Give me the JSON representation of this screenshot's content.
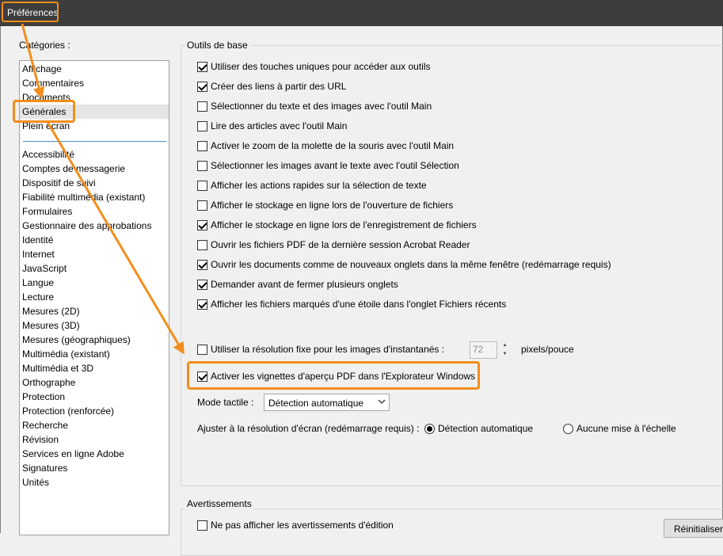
{
  "window": {
    "title": "Préférences"
  },
  "sidebar": {
    "label": "Catégories :",
    "top_items": [
      "Affichage",
      "Commentaires",
      "Documents",
      "Générales",
      "Plein écran"
    ],
    "selected": "Générales",
    "items": [
      "Accessibilité",
      "Comptes de messagerie",
      "Dispositif de suivi",
      "Fiabilité multimédia (existant)",
      "Formulaires",
      "Gestionnaire des approbations",
      "Identité",
      "Internet",
      "JavaScript",
      "Langue",
      "Lecture",
      "Mesures (2D)",
      "Mesures (3D)",
      "Mesures (géographiques)",
      "Multimédia (existant)",
      "Multimédia et 3D",
      "Orthographe",
      "Protection",
      "Protection (renforcée)",
      "Recherche",
      "Révision",
      "Services en ligne Adobe",
      "Signatures",
      "Unités"
    ]
  },
  "basic_tools": {
    "title": "Outils de base",
    "options": [
      {
        "label": "Utiliser des touches uniques pour accéder aux outils",
        "checked": true
      },
      {
        "label": "Créer des liens à partir des URL",
        "checked": true
      },
      {
        "label": "Sélectionner du texte et des images avec l'outil Main",
        "checked": false
      },
      {
        "label": "Lire des articles avec l'outil Main",
        "checked": false
      },
      {
        "label": "Activer le zoom de la molette de la souris avec l'outil Main",
        "checked": false
      },
      {
        "label": "Sélectionner les images avant le texte avec l'outil Sélection",
        "checked": false
      },
      {
        "label": "Afficher les actions rapides sur la sélection de texte",
        "checked": false
      },
      {
        "label": "Afficher le stockage en ligne lors de l'ouverture de fichiers",
        "checked": false
      },
      {
        "label": "Afficher le stockage en ligne lors de l'enregistrement de fichiers",
        "checked": true
      },
      {
        "label": "Ouvrir les fichiers PDF de la dernière session Acrobat Reader",
        "checked": false
      },
      {
        "label": "Ouvrir les documents comme de nouveaux onglets dans la même fenêtre (redémarrage requis)",
        "checked": true
      },
      {
        "label": "Demander avant de fermer plusieurs onglets",
        "checked": true
      },
      {
        "label": "Afficher les fichiers marqués d'une étoile dans l'onglet Fichiers récents",
        "checked": true
      }
    ],
    "snapshot": {
      "label": "Utiliser la résolution fixe pour les images d'instantanés :",
      "checked": false,
      "value": "72",
      "unit": "pixels/pouce"
    },
    "thumbnails": {
      "label": "Activer les vignettes d'aperçu PDF dans l'Explorateur Windows",
      "checked": true
    },
    "touch_mode": {
      "label": "Mode tactile :",
      "value": "Détection automatique"
    },
    "scaling": {
      "label": "Ajuster à la résolution d'écran (redémarrage requis) :",
      "option_auto": "Détection automatique",
      "option_none": "Aucune mise à l'échelle",
      "selected": "auto"
    }
  },
  "warnings": {
    "title": "Avertissements",
    "no_edit_warnings": {
      "label": "Ne pas afficher les avertissements d'édition",
      "checked": false
    },
    "reset_label": "Réinitialiser"
  },
  "colors": {
    "highlight": "#f28e1c",
    "titlebar": "#3d3d3d",
    "separator": "#4a90c8"
  }
}
